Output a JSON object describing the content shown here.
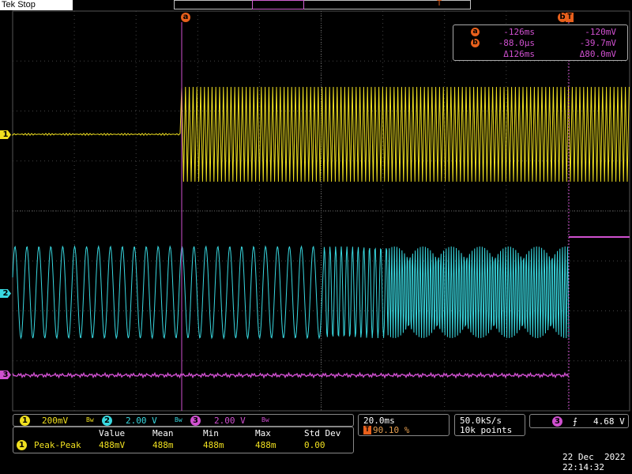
{
  "header": {
    "brand": "Tek",
    "status": "Stop",
    "trigger_pos_glyph": "T"
  },
  "cursors": {
    "a_label": "a",
    "b_label": "b",
    "readout": {
      "a_time": "-126ms",
      "a_volt": "-120mV",
      "b_time": "-88.0μs",
      "b_volt": "-39.7mV",
      "delta_time": "Δ126ms",
      "delta_volt": "Δ80.0mV"
    }
  },
  "channels": [
    {
      "id": "1",
      "color": "#f0e020",
      "scale": "200mV",
      "coupling_glyph": "Bw"
    },
    {
      "id": "2",
      "color": "#38d8e0",
      "scale": "2.00 V",
      "coupling_glyph": "Bw"
    },
    {
      "id": "3",
      "color": "#d050d0",
      "scale": "2.00 V",
      "coupling_glyph": "Bw"
    }
  ],
  "timebase": {
    "scale": "20.0ms",
    "trigger_tag": "T",
    "position": "90.10 %"
  },
  "acquisition": {
    "rate": "50.0kS/s",
    "points": "10k points"
  },
  "trigger": {
    "source": "3",
    "slope_glyph": "⨍",
    "level": "4.68 V"
  },
  "measurement": {
    "headers": [
      "Value",
      "Mean",
      "Min",
      "Max",
      "Std Dev"
    ],
    "source": "1",
    "name": "Peak-Peak",
    "values": [
      "488mV",
      "488m",
      "488m",
      "488m",
      "0.00"
    ]
  },
  "clock": {
    "date": "22 Dec  2022",
    "time": "22:14:32"
  }
}
